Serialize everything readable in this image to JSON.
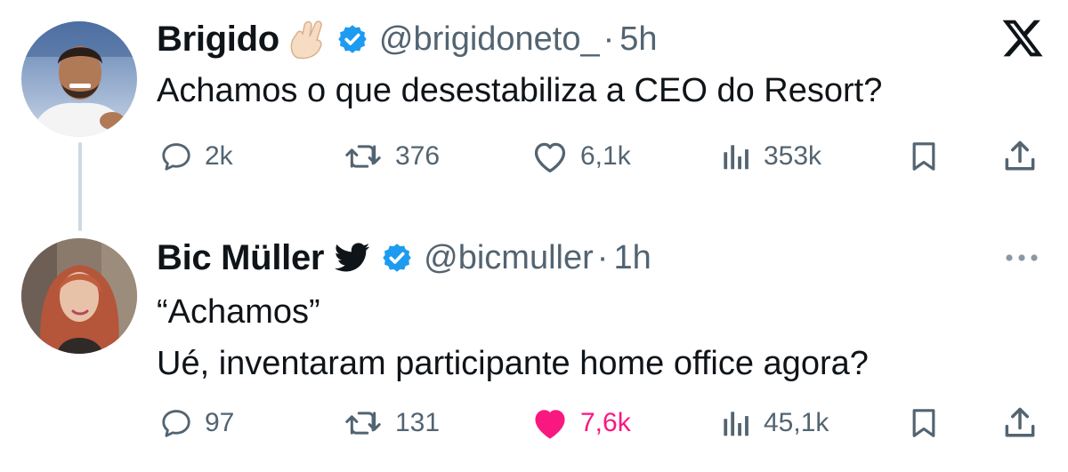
{
  "tweets": [
    {
      "author": "Brigido",
      "emoji": "crossed-fingers-emoji",
      "handle": "@brigidoneto_",
      "separator": "·",
      "time": "5h",
      "text_lines": [
        "Achamos o que desestabiliza a CEO do Resort?"
      ],
      "replies": "2k",
      "reposts": "376",
      "likes": "6,1k",
      "views": "353k",
      "liked": false
    },
    {
      "author": "Bic Müller",
      "handle": "@bicmuller",
      "separator": "·",
      "time": "1h",
      "text_lines": [
        "“Achamos”",
        "Ué, inventaram participante home office agora?"
      ],
      "replies": "97",
      "reposts": "131",
      "likes": "7,6k",
      "views": "45,1k",
      "liked": true
    }
  ],
  "colors": {
    "text": "#0f1419",
    "muted": "#536471",
    "verified": "#1d9bf0",
    "like": "#f91880",
    "thread_line": "#cfd9de"
  }
}
